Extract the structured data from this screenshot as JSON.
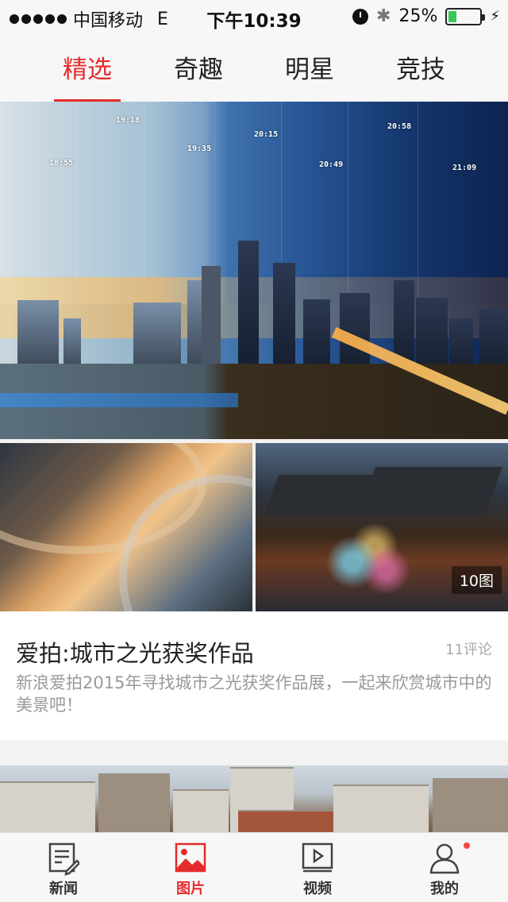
{
  "status_bar": {
    "carrier": "中国移动",
    "network": "E",
    "time": "下午10:39",
    "battery": "25%",
    "battery_level": 0.25
  },
  "tabs": [
    {
      "label": "精选",
      "active": true
    },
    {
      "label": "奇趣",
      "active": false
    },
    {
      "label": "明星",
      "active": false
    },
    {
      "label": "竞技",
      "active": false
    }
  ],
  "hero": {
    "timestamps": [
      "18:55",
      "19:18",
      "19:35",
      "20:15",
      "20:49",
      "20:58",
      "21:09"
    ]
  },
  "thumbs": {
    "count_badge": "10图"
  },
  "article": {
    "title": "爱拍:城市之光获奖作品",
    "comments": "11评论",
    "description": "新浪爱拍2015年寻找城市之光获奖作品展，一起来欣赏城市中的美景吧！"
  },
  "bottom_nav": [
    {
      "label": "新闻",
      "icon": "news-icon",
      "active": false
    },
    {
      "label": "图片",
      "icon": "image-icon",
      "active": true
    },
    {
      "label": "视频",
      "icon": "video-icon",
      "active": false
    },
    {
      "label": "我的",
      "icon": "profile-icon",
      "active": false
    }
  ],
  "colors": {
    "accent": "#e52b2b",
    "background": "#f2f2f2",
    "notification_dot": "#f04848"
  }
}
